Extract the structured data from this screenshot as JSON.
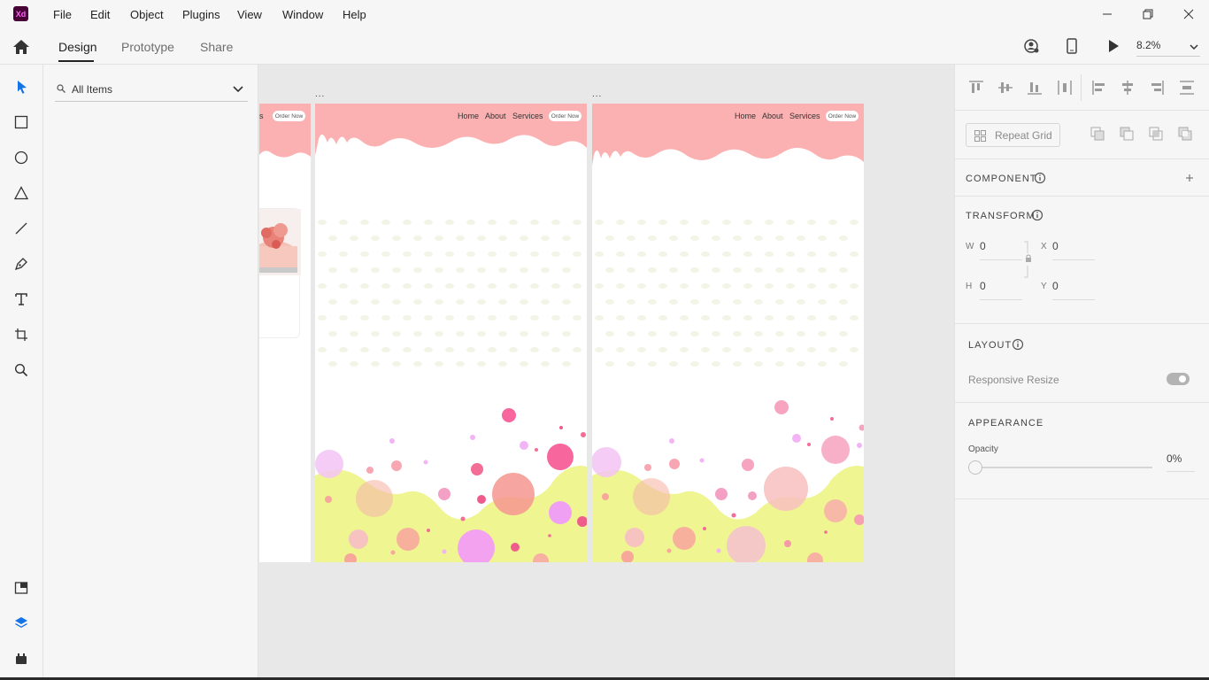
{
  "app": {
    "logo_text": "Xd"
  },
  "menu": {
    "items": [
      "File",
      "Edit",
      "Object",
      "Plugins",
      "View",
      "Window",
      "Help"
    ]
  },
  "modes": {
    "tabs": [
      "Design",
      "Prototype",
      "Share"
    ],
    "active": "Design"
  },
  "toolbar": {
    "zoom": "8.2%"
  },
  "layers": {
    "filter_label": "All Items"
  },
  "artboards": {
    "partial": {
      "nav_suffix": "s",
      "order_label": "Order Now"
    },
    "board1": {
      "nav": [
        "Home",
        "About",
        "Services"
      ],
      "order_label": "Order Now",
      "label": "..."
    },
    "board2": {
      "nav": [
        "Home",
        "About",
        "Services"
      ],
      "order_label": "Order Now",
      "label": "..."
    }
  },
  "properties": {
    "repeat_grid_label": "Repeat Grid",
    "component_title": "COMPONENT",
    "transform_title": "TRANSFORM",
    "w_label": "W",
    "w_value": "0",
    "x_label": "X",
    "x_value": "0",
    "h_label": "H",
    "h_value": "0",
    "y_label": "Y",
    "y_value": "0",
    "layout_title": "LAYOUT",
    "responsive_label": "Responsive Resize",
    "appearance_title": "APPEARANCE",
    "opacity_label": "Opacity",
    "opacity_value": "0%"
  },
  "colors": {
    "header_pink": "#fbb1b1",
    "ground_yellow": "#eef591",
    "accent_blue": "#1473e6"
  }
}
